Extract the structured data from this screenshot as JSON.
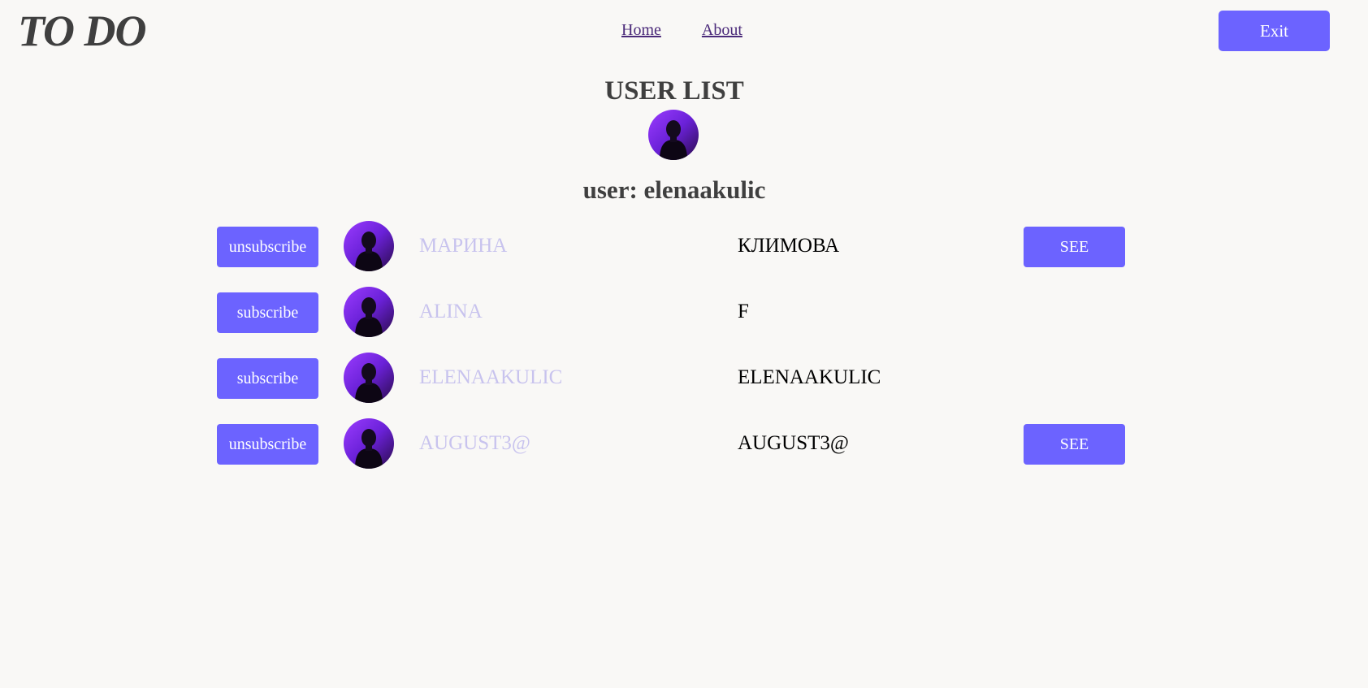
{
  "header": {
    "logo": "TO DO",
    "nav": [
      {
        "label": "Home"
      },
      {
        "label": "About"
      }
    ],
    "exit_label": "Exit"
  },
  "page": {
    "title": "USER LIST",
    "current_user": "user: elenaakulic",
    "avatar_icon": "user-silhouette-avatar"
  },
  "users": [
    {
      "action": "unsubscribe",
      "first_name": "МАРИНА",
      "last_name": "КЛИМОВА",
      "see_label": "SEE",
      "show_see": true
    },
    {
      "action": "subscribe",
      "first_name": "ALINA",
      "last_name": "F",
      "see_label": "",
      "show_see": false
    },
    {
      "action": "subscribe",
      "first_name": "ELENAAKULIC",
      "last_name": "ELENAAKULIC",
      "see_label": "",
      "show_see": false
    },
    {
      "action": "unsubscribe",
      "first_name": "AUGUST3@",
      "last_name": "AUGUST3@",
      "see_label": "SEE",
      "show_see": true
    }
  ],
  "colors": {
    "accent": "#6c63ff",
    "background": "#f9f8f6",
    "first_name": "#c8c3ee",
    "nav_link": "#4b2a7a"
  }
}
